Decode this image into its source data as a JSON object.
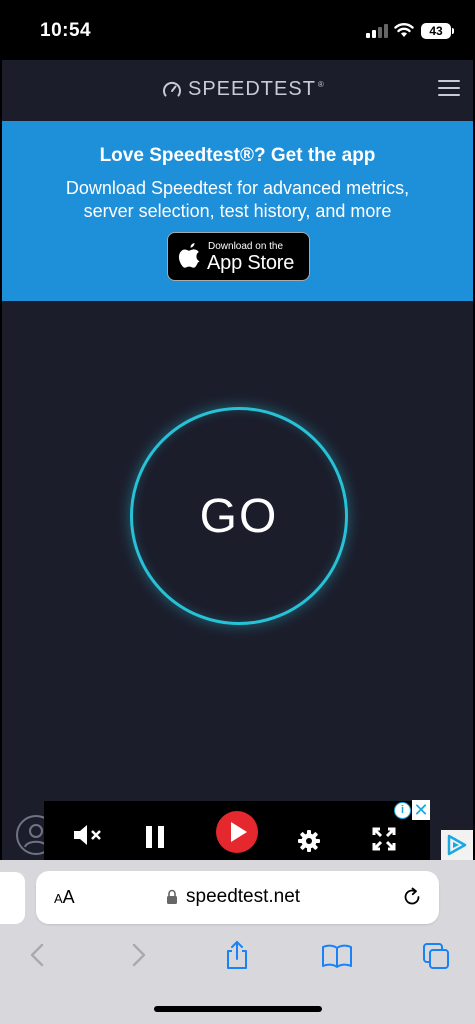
{
  "status_bar": {
    "time": "10:54",
    "battery": "43"
  },
  "header": {
    "brand": "SPEEDTEST",
    "trademark": "®"
  },
  "promo": {
    "title": "Love Speedtest®? Get the app",
    "subtitle_line1": "Download Speedtest for advanced metrics,",
    "subtitle_line2": "server selection, test history, and more",
    "appstore_small": "Download on the",
    "appstore_big": "App Store"
  },
  "main": {
    "go_label": "GO"
  },
  "ad": {
    "close": "✕",
    "info": "i"
  },
  "browser": {
    "aa_small": "A",
    "aa_big": "A",
    "url": "speedtest.net"
  },
  "colors": {
    "page_bg": "#1c1d2b",
    "promo_bg": "#1e8fd9",
    "ring": "#27c2d6",
    "ios_blue": "#1a82f7",
    "ad_red": "#e5282d"
  }
}
